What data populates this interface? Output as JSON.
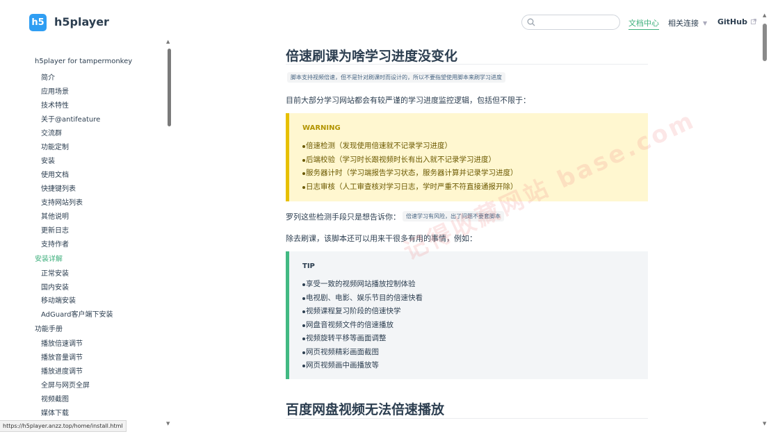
{
  "header": {
    "site_name": "h5player",
    "logo_text": "h5",
    "search": {
      "value": "",
      "placeholder": ""
    },
    "nav": {
      "docs": "文档中心",
      "links": "相关连接",
      "github": "GitHub"
    }
  },
  "sidebar": {
    "groups": [
      {
        "label": "h5player for tampermonkey",
        "items": [
          "简介",
          "应用场景",
          "技术特性",
          "关于@antifeature",
          "交流群",
          "功能定制",
          "安装",
          "使用文档",
          "快捷键列表",
          "支持网站列表",
          "其他说明",
          "更新日志",
          "支持作者"
        ]
      },
      {
        "label": "安装详解",
        "active": true,
        "items": [
          "正常安装",
          "国内安装",
          "移动端安装",
          "AdGuard客户端下安装"
        ]
      },
      {
        "label": "功能手册",
        "items": [
          "播放倍速调节",
          "播放音量调节",
          "播放进度调节",
          "全屏与网页全屏",
          "视频截图",
          "媒体下载"
        ]
      }
    ]
  },
  "status_bar": {
    "url": "https://h5player.anzz.top/home/install.html"
  },
  "content": {
    "h2_1": "倍速刷课为啥学习进度没变化",
    "note_1": "脚本支持视频倍速，但不是针对刷课时而设计的，所以不要指望使用脚本来刷学习进度",
    "para_1": "目前大部分学习网站都会有较严谨的学习进度监控逻辑，包括但不限于：",
    "warning": {
      "title": "WARNING",
      "items": [
        "倍速检测（发现使用倍速就不记录学习进度）",
        "后端校验（学习时长跟视频时长有出入就不记录学习进度）",
        "服务器计时（学习端报告学习状态，服务器计算并记录学习进度）",
        "日志审核（人工审查核对学习日志，学时严重不符直接通报开除）"
      ]
    },
    "para_2": "罗列这些检测手段只是想告诉你：",
    "note_2": "倍速学习有风险，出了问题不要套脚本",
    "para_3": "除去刷课，该脚本还可以用来干很多有用的事情，例如：",
    "tip": {
      "title": "TIP",
      "items": [
        "享受一致的视频网站播放控制体验",
        "电视剧、电影、娱乐节目的倍速快看",
        "视频课程复习阶段的倍速快学",
        "网盘音视频文件的倍速播放",
        "视频旋转平移等画面调整",
        "网页视频精彩画面截图",
        "网页视频画中画播放等"
      ]
    },
    "h2_2": "百度网盘视频无法倍速播放",
    "watermark": "记得收藏网站 base.com"
  },
  "colors": {
    "accent": "#3eaf7c",
    "warning_border": "#e7c000",
    "tip_border": "#42b983",
    "logo": "#2f9ef3"
  }
}
